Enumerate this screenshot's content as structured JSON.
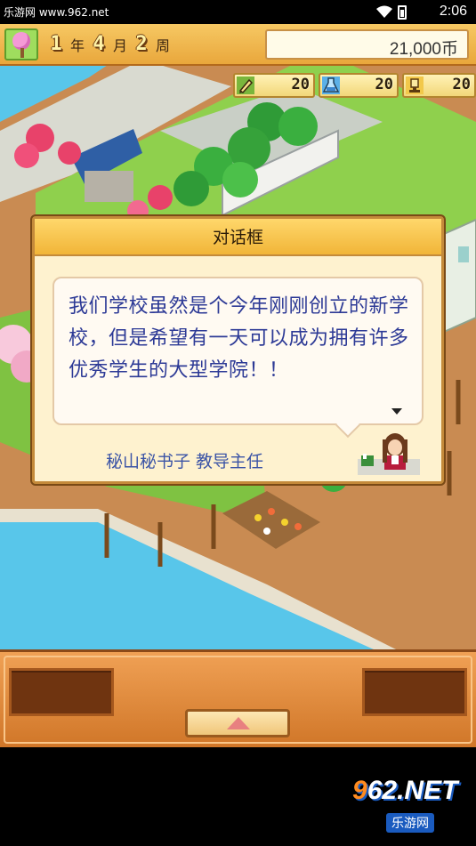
{
  "status_bar": {
    "watermark": "乐游网 www.962.net",
    "time": "2:06"
  },
  "hud": {
    "season_icon": "cherry-tree-icon",
    "year": "1",
    "year_unit": "年",
    "month": "4",
    "month_unit": "月",
    "week": "2",
    "week_unit": "周",
    "money": "21,000币"
  },
  "resources": [
    {
      "icon": "pencil-icon",
      "value": "20"
    },
    {
      "icon": "flask-icon",
      "value": "20"
    },
    {
      "icon": "trophy-icon",
      "value": "20"
    }
  ],
  "dialog": {
    "title": "对话框",
    "message": "我们学校虽然是个今年刚刚创立的新学校，但是希望有一天可以成为拥有许多优秀学生的大型学院！！",
    "speaker": "秘山秘书子 教导主任"
  },
  "controls": {
    "up_button_icon": "triangle-up-icon"
  },
  "watermark_logo": {
    "brand_prefix": "9",
    "brand_mid": "62",
    "brand_suffix": ".NET",
    "subtitle": "乐游网"
  },
  "colors": {
    "hud": "#f1b538",
    "dialog_text": "#2d3a96",
    "speaker_text": "#3b54a6",
    "panel": "#e0893a"
  }
}
